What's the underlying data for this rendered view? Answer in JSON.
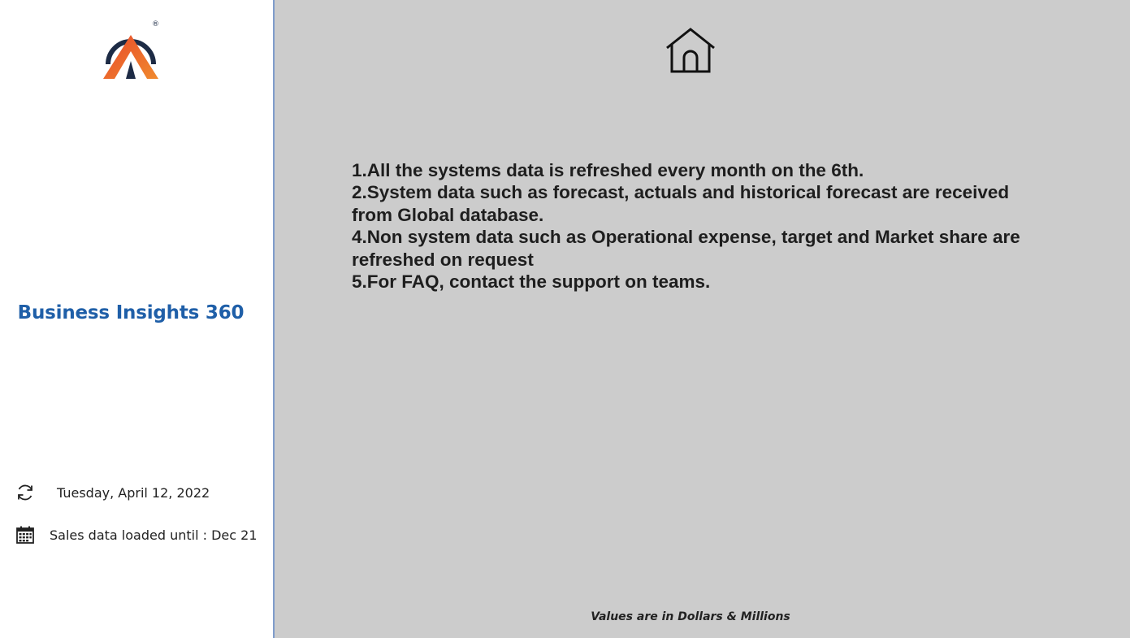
{
  "sidebar": {
    "logo_icon": "brand-logo-icon",
    "logo_registered_mark": "®",
    "app_title": "Business Insights 360",
    "refresh": {
      "icon": "refresh-icon",
      "text": "Tuesday, April 12, 2022"
    },
    "sales_loaded": {
      "icon": "calendar-icon",
      "text": "Sales data loaded until : Dec 21"
    }
  },
  "main": {
    "home_icon": "home-icon",
    "notes": [
      "1.All the systems data is refreshed every month on the 6th.",
      "2.System data such as forecast, actuals and historical forecast are received from Global database.",
      "4.Non system data such as Operational expense, target and Market share are refreshed on request",
      "5.For FAQ, contact the support on teams."
    ],
    "footer_note": "Values are in Dollars & Millions"
  },
  "colors": {
    "main_background": "#cccccc",
    "sidebar_background": "#ffffff",
    "title_blue": "#1f5fa8",
    "logo_red": "#e8492b",
    "logo_orange": "#f08a2e",
    "logo_navy": "#1d2b45"
  }
}
